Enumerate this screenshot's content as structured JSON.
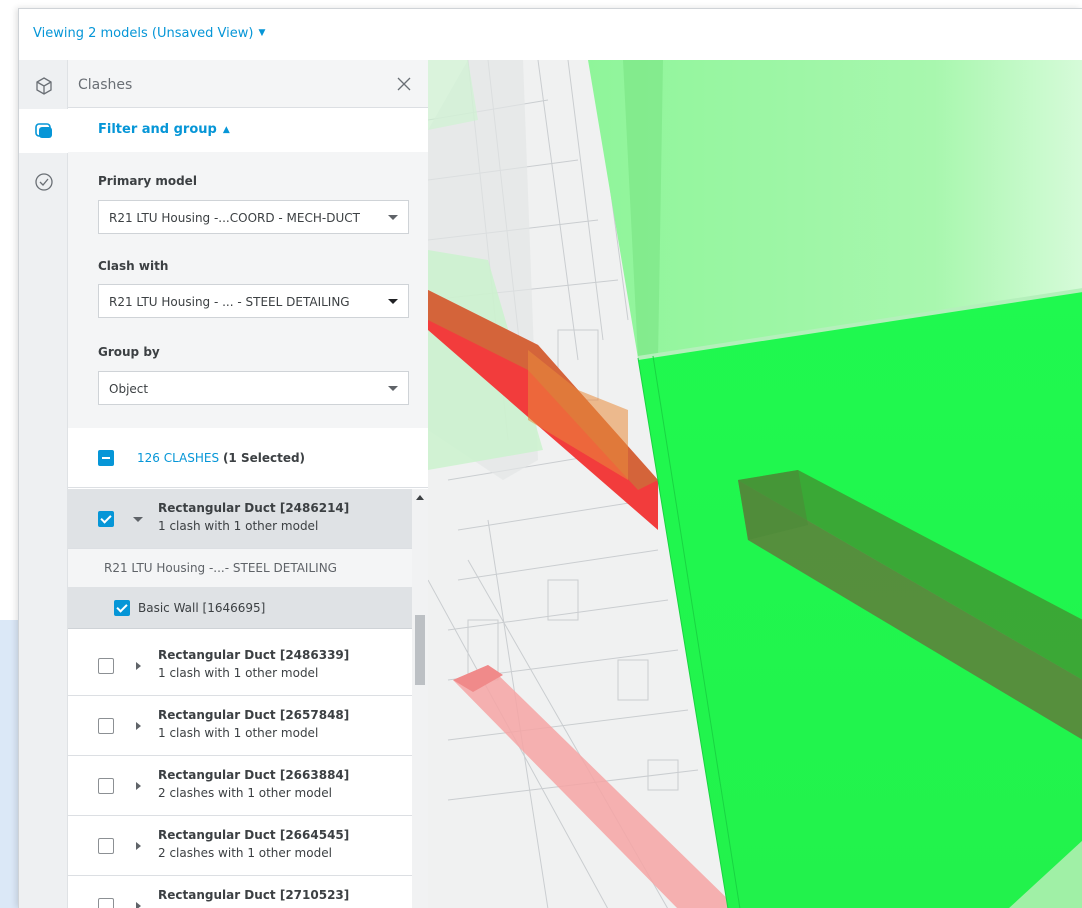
{
  "header": {
    "title": "Viewing 2 models (Unsaved View)"
  },
  "rail": {
    "icons": [
      "cube-icon",
      "layers-icon",
      "check-circle-icon"
    ],
    "active": "layers-icon"
  },
  "panel": {
    "title": "Clashes",
    "filter_group_label": "Filter and group",
    "primary_model": {
      "label": "Primary model",
      "value": "R21 LTU Housing -...COORD - MECH-DUCT"
    },
    "clash_with": {
      "label": "Clash with",
      "value": "R21 LTU Housing - ... - STEEL DETAILING"
    },
    "group_by": {
      "label": "Group by",
      "value": "Object"
    },
    "summary": {
      "count": "126 CLASHES",
      "selected": "(1 Selected)"
    },
    "items": [
      {
        "title": "Rectangular Duct [2486214]",
        "subtitle": "1 clash with 1 other model",
        "checked": true,
        "expanded": true
      },
      {
        "title": "Rectangular Duct [2486339]",
        "subtitle": "1 clash with 1 other model",
        "checked": false,
        "expanded": false
      },
      {
        "title": "Rectangular Duct [2657848]",
        "subtitle": "1 clash with 1 other model",
        "checked": false,
        "expanded": false
      },
      {
        "title": "Rectangular Duct [2663884]",
        "subtitle": "2 clashes with 1 other model",
        "checked": false,
        "expanded": false
      },
      {
        "title": "Rectangular Duct [2664545]",
        "subtitle": "2 clashes with 1 other model",
        "checked": false,
        "expanded": false
      },
      {
        "title": "Rectangular Duct [2710523]",
        "subtitle": "",
        "checked": false,
        "expanded": false
      }
    ],
    "expanded_detail": {
      "model": "R21 LTU Housing -...- STEEL DETAILING",
      "item": "Basic Wall [1646695]"
    }
  },
  "colors": {
    "accent": "#0696d7",
    "clash_green": "#1ff94f",
    "clash_red": "#f23c3c"
  }
}
